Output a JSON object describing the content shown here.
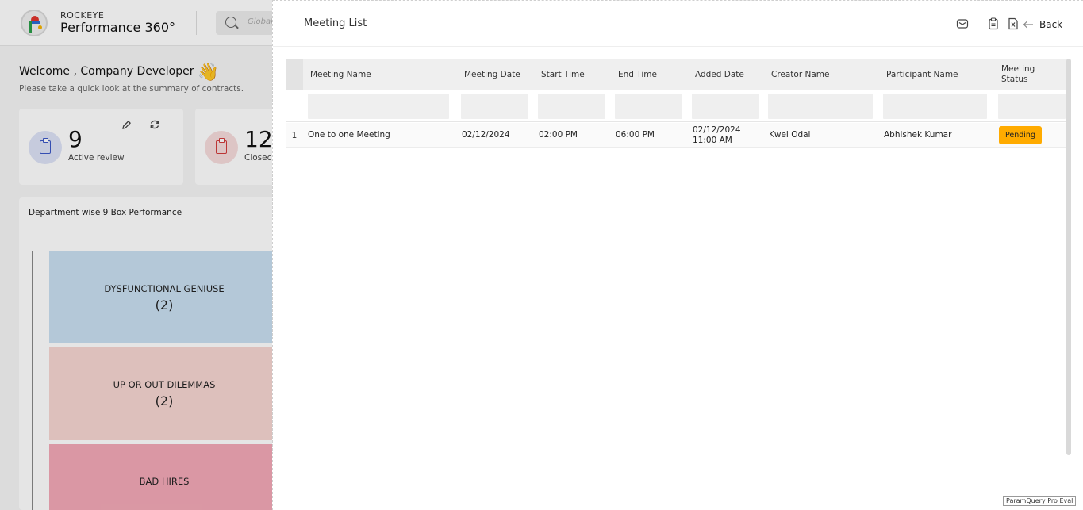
{
  "app": {
    "brand_small": "ROCKEYE",
    "brand_big": "Performance 360°",
    "search_placeholder": "Global"
  },
  "dashboard": {
    "welcome": "Welcome , Company Developer",
    "wave_emoji": "👋",
    "subtitle": "Please take a quick look at the summary of contracts.",
    "cards": [
      {
        "value": "9",
        "label": "Active review"
      },
      {
        "value": "12",
        "label": "Closec"
      }
    ],
    "dept_title": "Department wise 9 Box Performance",
    "boxes": [
      {
        "name": "DYSFUNCTIONAL GENIUSE",
        "count": "(2)"
      },
      {
        "name": "UP OR OUT DILEMMAS",
        "count": "(2)"
      },
      {
        "name": "BAD HIRES"
      }
    ]
  },
  "drawer": {
    "title": "Meeting List",
    "back_label": "Back",
    "columns": {
      "meeting_name": "Meeting Name",
      "meeting_date": "Meeting Date",
      "start_time": "Start Time",
      "end_time": "End Time",
      "added_date": "Added Date",
      "creator_name": "Creator Name",
      "participant_name": "Participant Name",
      "meeting_status": "Meeting Status"
    },
    "rows": [
      {
        "num": "1",
        "meeting_name": "One to one Meeting",
        "meeting_date": "02/12/2024",
        "start_time": "02:00 PM",
        "end_time": "06:00 PM",
        "added_date": "02/12/2024 11:00 AM",
        "creator_name": "Kwei Odai",
        "participant_name": "Abhishek Kumar",
        "meeting_status": "Pending"
      }
    ],
    "status_color": "#ffab00",
    "watermark": "ParamQuery Pro Eval"
  }
}
